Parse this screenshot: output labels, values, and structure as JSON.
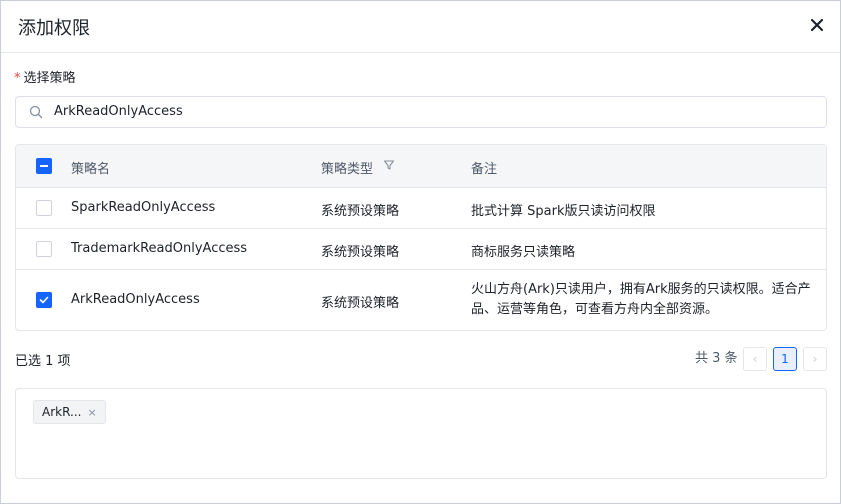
{
  "dialog": {
    "title": "添加权限",
    "close_glyph": "✕"
  },
  "form": {
    "required_mark": "*",
    "label": "选择策略"
  },
  "search": {
    "value": "ArkReadOnlyAccess"
  },
  "table": {
    "headers": {
      "name": "策略名",
      "type": "策略类型",
      "note": "备注"
    },
    "rows": [
      {
        "name": "SparkReadOnlyAccess",
        "type": "系统预设策略",
        "note": "批式计算 Spark版只读访问权限",
        "checked": false
      },
      {
        "name": "TrademarkReadOnlyAccess",
        "type": "系统预设策略",
        "note": "商标服务只读策略",
        "checked": false
      },
      {
        "name": "ArkReadOnlyAccess",
        "type": "系统预设策略",
        "note": "火山方舟(Ark)只读用户，拥有Ark服务的只读权限。适合产品、运营等角色，可查看方舟内全部资源。",
        "checked": true
      }
    ]
  },
  "footer": {
    "selected_text": "已选 1 项",
    "total_text": "共 3 条",
    "prev": "‹",
    "page": "1",
    "next": "›"
  },
  "selected_tags": [
    {
      "label": "ArkR...",
      "close": "×"
    }
  ],
  "colors": {
    "accent": "#1664ff",
    "required": "#f53f3f",
    "header_bg": "#f5f6f8"
  }
}
